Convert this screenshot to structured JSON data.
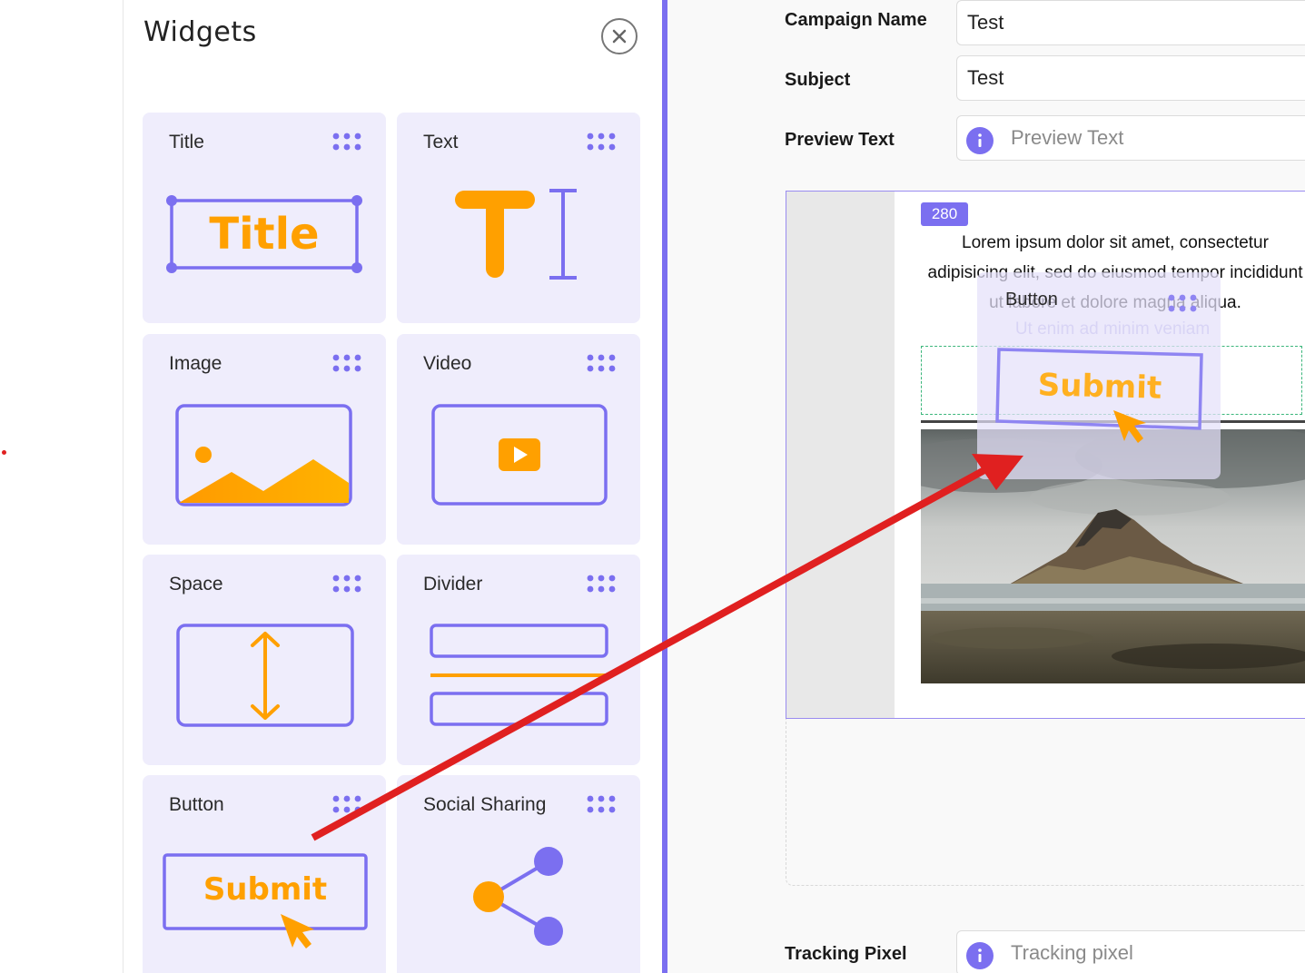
{
  "widgets_panel": {
    "title": "Widgets",
    "widgets": [
      {
        "label": "Title",
        "art_text": "Title"
      },
      {
        "label": "Text"
      },
      {
        "label": "Image"
      },
      {
        "label": "Video"
      },
      {
        "label": "Space"
      },
      {
        "label": "Divider"
      },
      {
        "label": "Button",
        "art_text": "Submit"
      },
      {
        "label": "Social Sharing"
      }
    ]
  },
  "form": {
    "campaign_name_label": "Campaign Name",
    "campaign_name_value": "Test",
    "subject_label": "Subject",
    "subject_value": "Test",
    "preview_text_label": "Preview Text",
    "preview_text_placeholder": "Preview Text",
    "tracking_pixel_label": "Tracking Pixel",
    "tracking_pixel_placeholder": "Tracking pixel"
  },
  "canvas": {
    "width_badge": "280",
    "lorem_text": "Lorem ipsum dolor sit amet, consectetur adipisicing elit, sed do eiusmod tempor incididunt ut labore et dolore magna aliqua.",
    "faded_text": "Ut enim ad minim veniam"
  },
  "drag_ghost": {
    "label": "Button",
    "art_text": "Submit"
  },
  "colors": {
    "accent": "#7b6ff0",
    "orange": "#ffa000",
    "arrow": "#e02020"
  }
}
